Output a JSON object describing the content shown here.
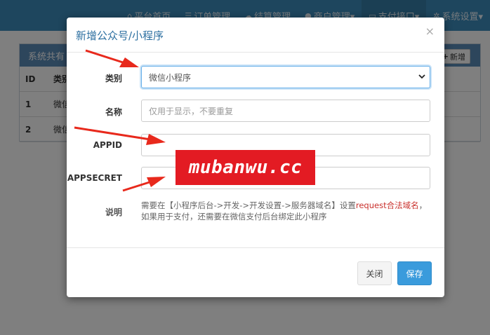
{
  "nav": {
    "items": [
      {
        "icon": "home-icon",
        "glyph": "⌂",
        "label": "平台首页"
      },
      {
        "icon": "list-icon",
        "glyph": "☰",
        "label": "订单管理"
      },
      {
        "icon": "cloud-icon",
        "glyph": "☁",
        "label": "结算管理"
      },
      {
        "icon": "user-icon",
        "glyph": "●",
        "label": "商户管理▾"
      },
      {
        "icon": "card-icon",
        "glyph": "▭",
        "label": "支付接口▾"
      },
      {
        "icon": "gear-icon",
        "glyph": "✲",
        "label": "系统设置▾"
      }
    ]
  },
  "panel": {
    "title": "系统共有",
    "add_label": "新增",
    "header": {
      "id": "ID",
      "type": "类别"
    },
    "rows": [
      {
        "id": "1",
        "type": "微信"
      },
      {
        "id": "2",
        "type": "微信"
      }
    ]
  },
  "modal": {
    "title": "新增公众号/小程序",
    "close_glyph": "×",
    "fields": {
      "type": {
        "label": "类别",
        "value": "微信小程序"
      },
      "name": {
        "label": "名称",
        "placeholder": "仅用于显示，不要重复"
      },
      "appid": {
        "label": "APPID",
        "value": ""
      },
      "appsecret": {
        "label": "APPSECRET",
        "value": ""
      }
    },
    "note": {
      "label": "说明",
      "text_before": "需要在【小程序后台->开发->开发设置->服务器域名】设置",
      "highlight": "request合法域名",
      "text_after": "，如果用于支付，还需要在微信支付后台绑定此小程序"
    },
    "buttons": {
      "close": "关闭",
      "save": "保存"
    }
  },
  "watermark": {
    "text": "mubanwu.cc"
  },
  "colors": {
    "navbar": "#3c8dbc",
    "accent": "#3a9bdc",
    "watermark": "#e31b23",
    "arrow": "#e8291c"
  }
}
